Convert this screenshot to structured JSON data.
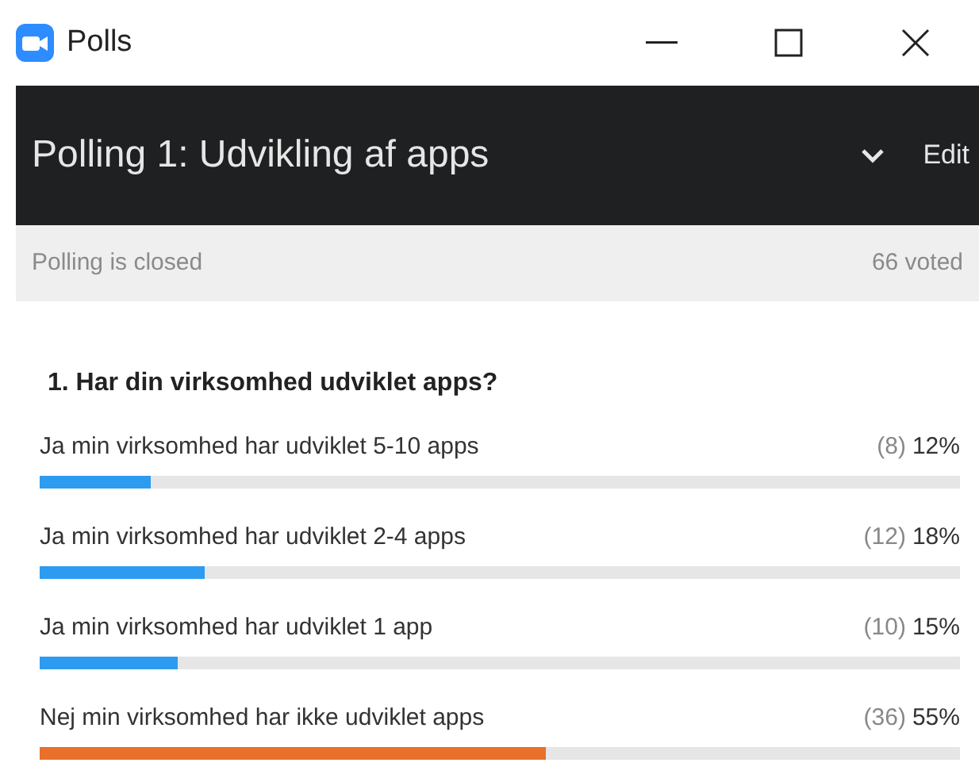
{
  "window": {
    "title": "Polls"
  },
  "header": {
    "title": "Polling 1: Udvikling af apps",
    "edit": "Edit"
  },
  "status_bar": {
    "state": "Polling is closed",
    "votes": "66 voted"
  },
  "question": "1. Har din virksomhed udviklet apps?",
  "options": [
    {
      "label": "Ja min virksomhed har udviklet 5-10 apps",
      "count": "(8)",
      "percent": "12%",
      "level": 0.12,
      "color": "#2d9bf0"
    },
    {
      "label": "Ja min virksomhed har udviklet 2-4 apps",
      "count": "(12)",
      "percent": "18%",
      "level": 0.18,
      "color": "#2d9bf0"
    },
    {
      "label": "Ja min virksomhed har udviklet 1 app",
      "count": "(10)",
      "percent": "15%",
      "level": 0.15,
      "color": "#2d9bf0"
    },
    {
      "label": "Nej min virksomhed har ikke udviklet apps",
      "count": "(36)",
      "percent": "55%",
      "level": 0.55,
      "color": "#e8702a"
    }
  ]
}
